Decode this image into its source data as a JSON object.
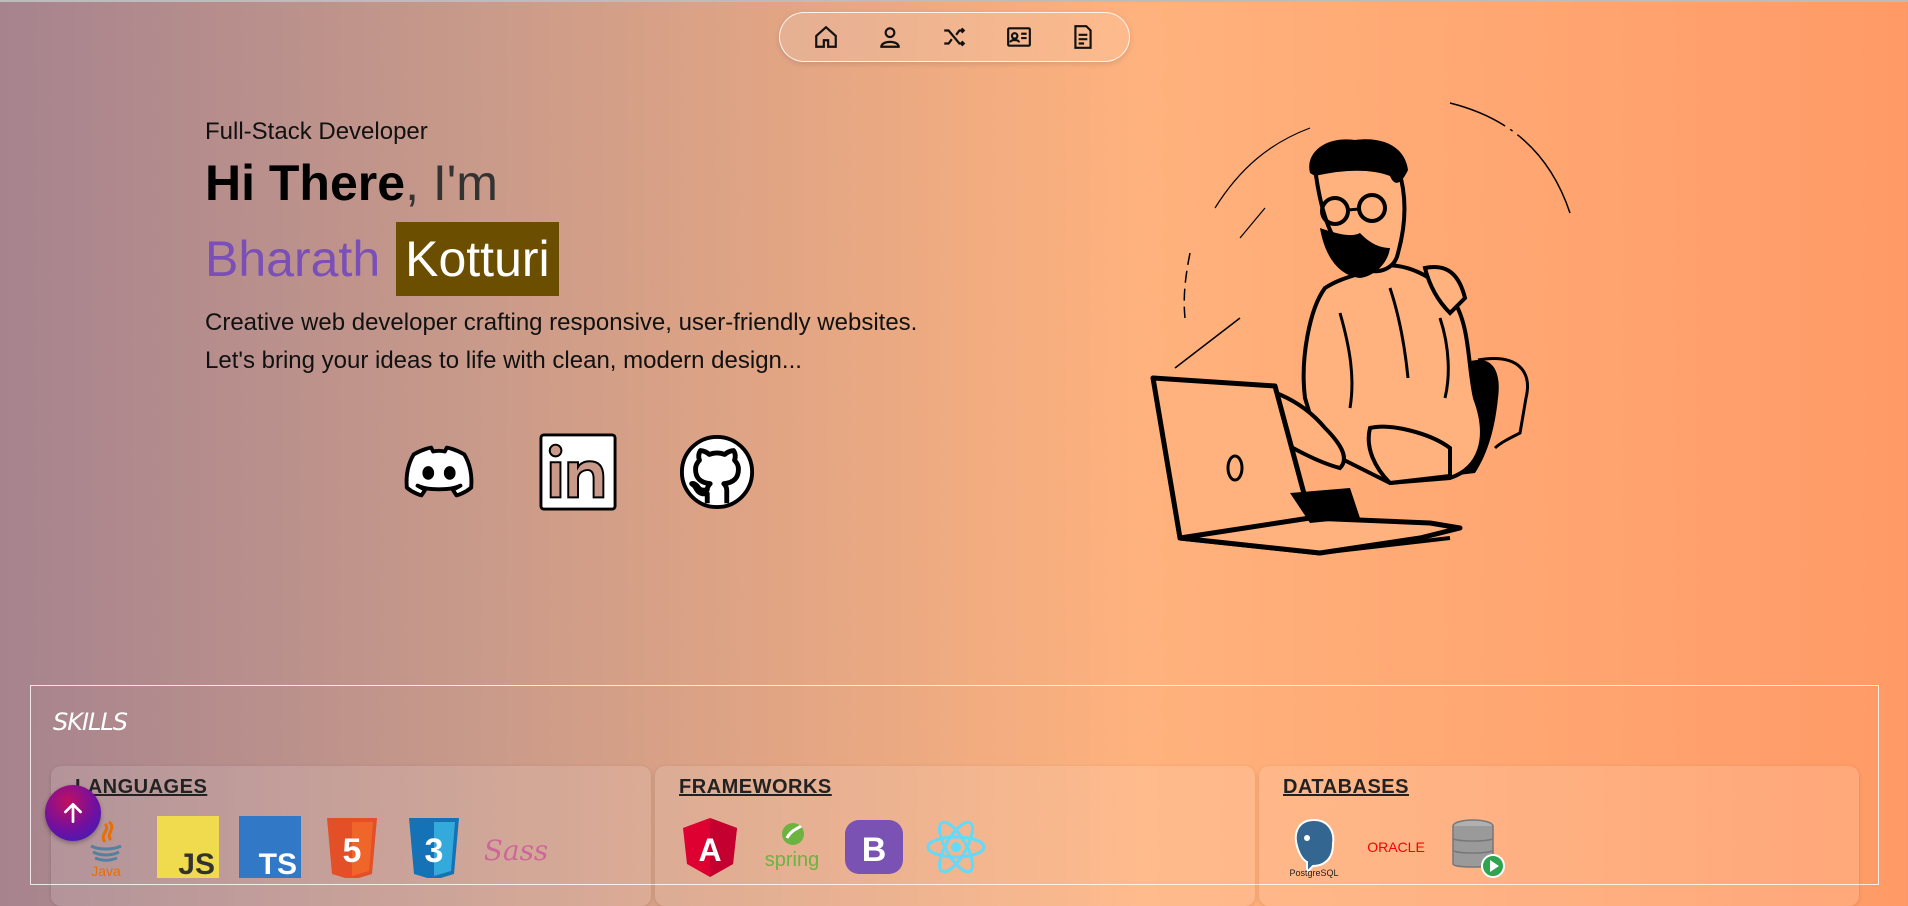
{
  "nav": {
    "items": [
      {
        "icon": "home-icon"
      },
      {
        "icon": "user-icon"
      },
      {
        "icon": "projects-icon"
      },
      {
        "icon": "contact-card-icon"
      },
      {
        "icon": "resume-icon"
      }
    ]
  },
  "hero": {
    "role": "Full-Stack Developer",
    "greeting_bold": "Hi There",
    "greeting_rest": ", I'm",
    "first_name": "Bharath",
    "last_name": "Kotturi",
    "desc_line1": "Creative web developer crafting responsive, user-friendly websites.",
    "desc_line2": "Let's bring your ideas to life with clean, modern design..."
  },
  "socials": [
    {
      "icon": "discord-icon"
    },
    {
      "icon": "linkedin-icon"
    },
    {
      "icon": "github-icon"
    }
  ],
  "skills": {
    "title": "SKILLS",
    "categories": [
      {
        "title": "LANGUAGES",
        "logos": [
          "java-icon",
          "javascript-icon",
          "typescript-icon",
          "html5-icon",
          "css3-icon",
          "sass-icon"
        ],
        "logo_texts": {
          "java": "Java",
          "js": "JS",
          "ts": "TS",
          "html": "5",
          "css": "3",
          "sass": "Sass"
        }
      },
      {
        "title": "FRAMEWORKS",
        "logos": [
          "angular-icon",
          "spring-icon",
          "bootstrap-icon",
          "react-icon"
        ],
        "logo_texts": {
          "angular": "A",
          "spring": "spring",
          "bootstrap": "B"
        }
      },
      {
        "title": "DATABASES",
        "logos": [
          "postgresql-icon",
          "oracle-icon",
          "database-icon"
        ],
        "logo_texts": {
          "postgres": "PostgreSQL",
          "oracle": "ORACLE"
        }
      }
    ]
  },
  "colors": {
    "accent_name": "#7b4fb8",
    "highlight_bg": "#6b4e00"
  }
}
